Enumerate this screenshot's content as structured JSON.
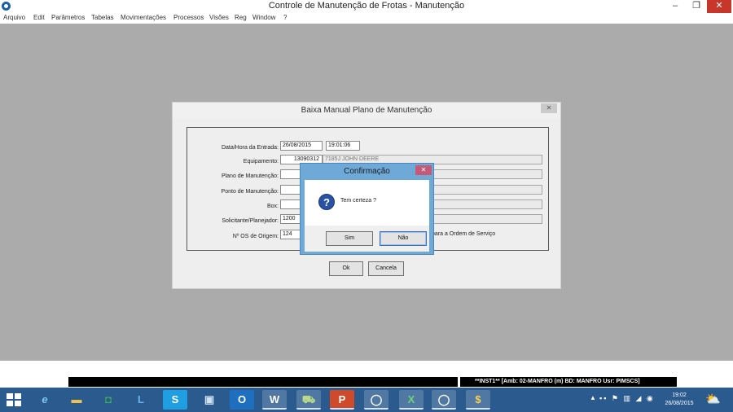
{
  "window": {
    "title": "Controle de Manutenção de Frotas - Manutenção",
    "minimize": "–",
    "maximize": "❐",
    "close": "✕"
  },
  "menu": [
    "Arquivo",
    "Edit",
    "Parâmetros",
    "Tabelas",
    "Movimentações",
    "Processos",
    "Visões",
    "Reg",
    "Window",
    "?"
  ],
  "dialog": {
    "title": "Baixa Manual Plano de Manutenção",
    "close": "✕",
    "labels": {
      "data_hora": "Data/Hora da Entrada:",
      "equipamento": "Equipamento:",
      "plano": "Plano de Manutenção:",
      "ponto": "Ponto de Manutenção:",
      "box": "Box:",
      "solicitante": "Solicitante/Planejador:",
      "os_origem": "Nº OS de Origem:"
    },
    "values": {
      "data": "26/08/2015",
      "hora": "19:01:06",
      "equipamento_codigo": "13090312",
      "equipamento_desc": "7185J JOHN DEERE",
      "solicitante": "1200",
      "os_origem": "124"
    },
    "os_note": "para a Ordem de Serviço",
    "ok": "Ok",
    "cancel": "Cancela"
  },
  "confirm": {
    "title": "Confirmação",
    "close": "✕",
    "icon": "?",
    "message": "Tem certeza ?",
    "yes": "Sim",
    "no": "Não"
  },
  "status": {
    "info": "**INST1**   [Amb: 02-MANFRO  (m) BD: MANFRO Usr: PIMSCS]"
  },
  "taskbar": {
    "apps": [
      {
        "name": "internet-explorer-icon",
        "glyph": "e"
      },
      {
        "name": "file-explorer-icon",
        "glyph": "▬"
      },
      {
        "name": "store-icon",
        "glyph": "◘"
      },
      {
        "name": "lync-icon",
        "glyph": "L"
      },
      {
        "name": "skype-icon",
        "glyph": "S"
      },
      {
        "name": "remote-desktop-icon",
        "glyph": "▣"
      },
      {
        "name": "outlook-icon",
        "glyph": "O"
      },
      {
        "name": "word-icon",
        "glyph": "W"
      },
      {
        "name": "fleet-app-icon",
        "glyph": "⛟"
      },
      {
        "name": "powerpoint-icon",
        "glyph": "P"
      },
      {
        "name": "app-circle-icon",
        "glyph": "◯"
      },
      {
        "name": "excel-icon",
        "glyph": "X"
      },
      {
        "name": "app-circle-icon-2",
        "glyph": "◯"
      },
      {
        "name": "money-app-icon",
        "glyph": "$"
      }
    ],
    "tray_arrow": "▲",
    "tray_icons": "▪▪ ⚑ ▥ ◢ ◉",
    "time": "19:02",
    "date": "26/08/2015",
    "weather": "⛅"
  },
  "colors": {
    "workspace": "#ababab",
    "accent": "#6fa9d7",
    "taskbar": "#2b5a8f",
    "close_red": "#c7362b"
  }
}
